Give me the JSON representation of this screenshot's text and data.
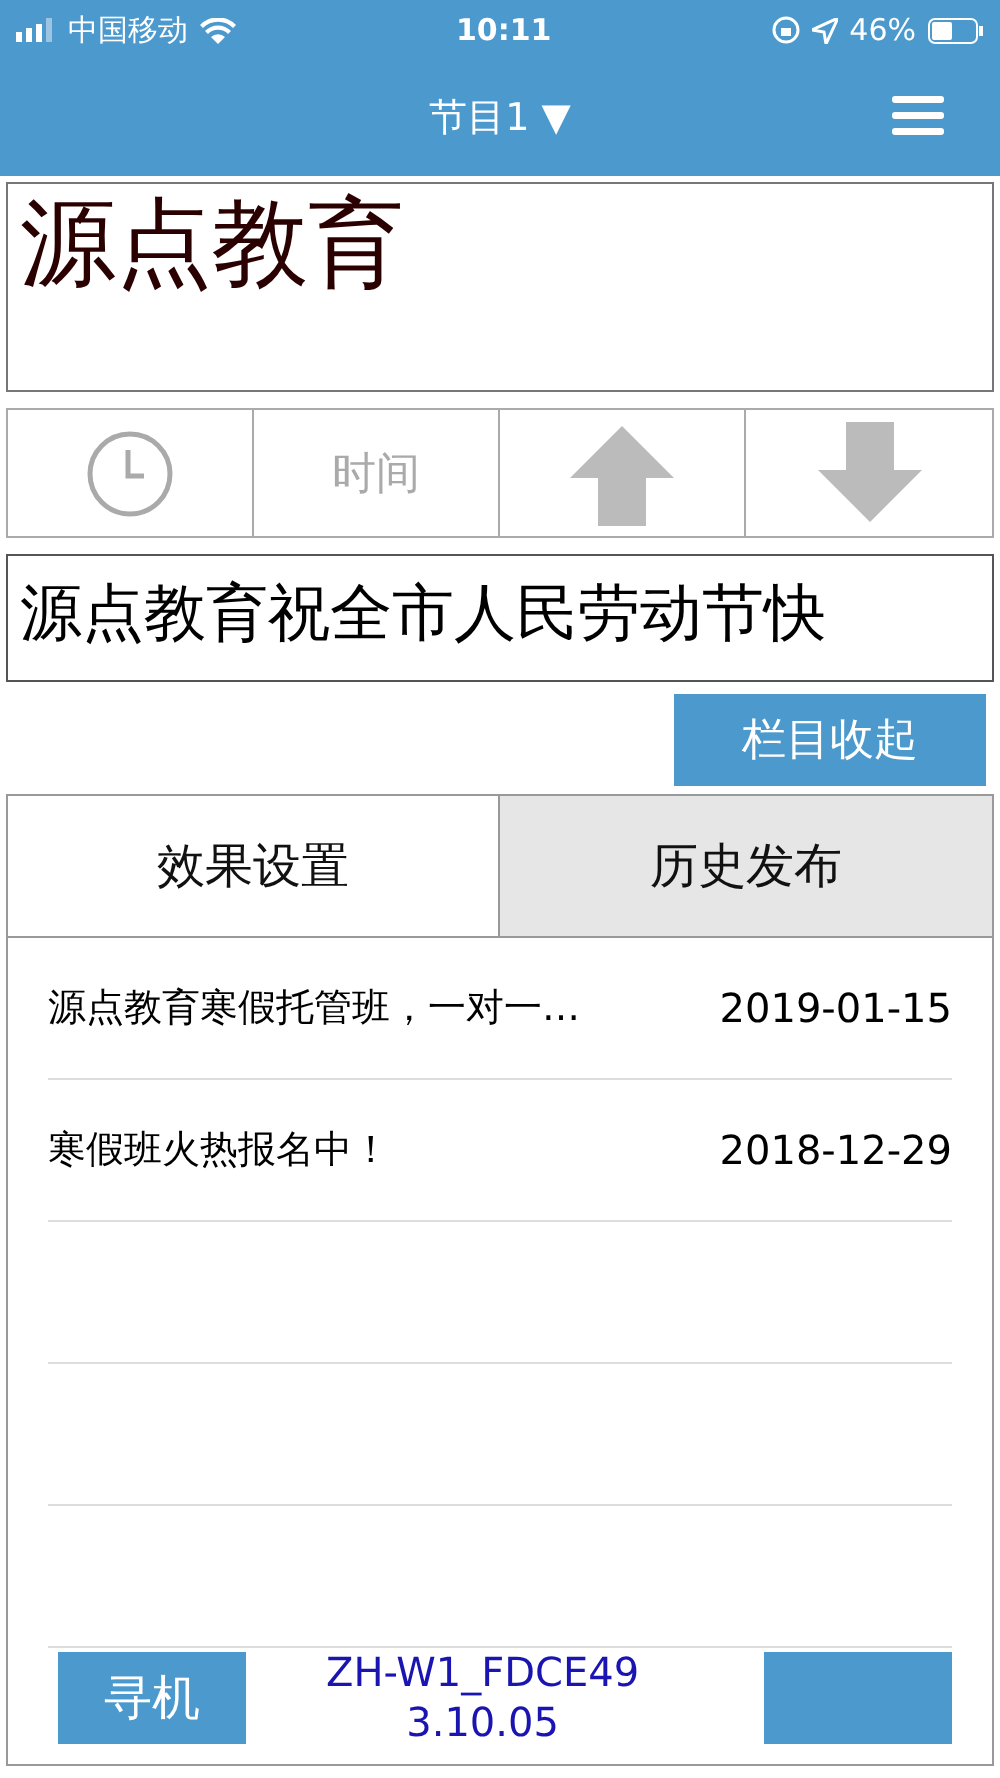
{
  "status_bar": {
    "carrier": "中国移动",
    "time": "10:11",
    "battery": "46%"
  },
  "nav": {
    "title": "节目1 ▼"
  },
  "banner": {
    "title": "源点教育"
  },
  "controls": [
    {
      "kind": "clock"
    },
    {
      "kind": "text",
      "label": "时间"
    },
    {
      "kind": "up"
    },
    {
      "kind": "down"
    }
  ],
  "marquee": {
    "text": "源点教育祝全市人民劳动节快"
  },
  "collapse_button": "栏目收起",
  "tabs": [
    {
      "label": "效果设置",
      "selected": true
    },
    {
      "label": "历史发布",
      "selected": false
    }
  ],
  "history": [
    {
      "title": "源点教育寒假托管班，一对一…",
      "date": "2019-01-15"
    },
    {
      "title": "寒假班火热报名中！",
      "date": "2018-12-29"
    }
  ],
  "footer": {
    "search_button": "寻机",
    "device": "ZH-W1_FDCE49",
    "version": "3.10.05"
  }
}
